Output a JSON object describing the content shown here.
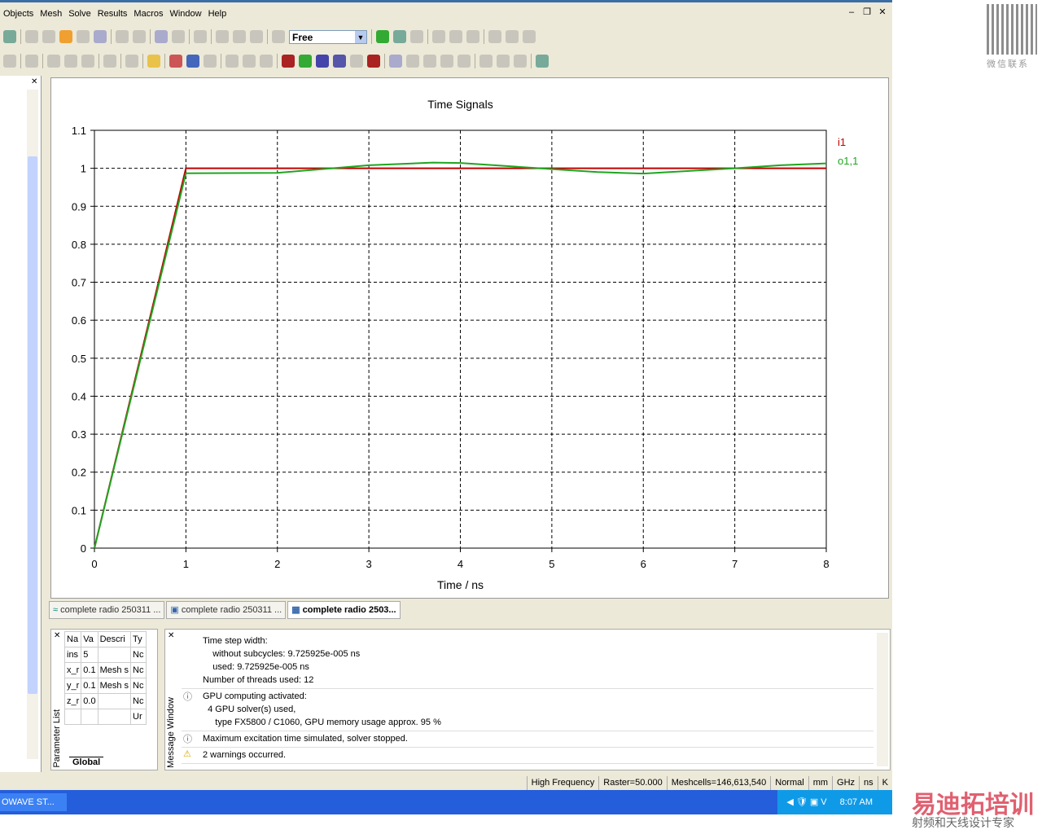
{
  "menu": [
    "Objects",
    "Mesh",
    "Solve",
    "Results",
    "Macros",
    "Window",
    "Help"
  ],
  "toolbar": {
    "view_mode": "Free"
  },
  "chart_tabs": [
    {
      "label": "complete radio 250311 ..."
    },
    {
      "label": "complete radio 250311 ..."
    },
    {
      "label": "complete radio 2503...",
      "active": true
    }
  ],
  "parameter_list": {
    "title": "Parameter List",
    "columns": [
      "Na",
      "Va",
      "Descri",
      "Ty"
    ],
    "rows": [
      [
        "ins",
        "5",
        "",
        "Nc"
      ],
      [
        "x_r",
        "0.1",
        "Mesh s",
        "Nc"
      ],
      [
        "y_r",
        "0.1",
        "Mesh s",
        "Nc"
      ],
      [
        "z_r",
        "0.0",
        "",
        "Nc"
      ],
      [
        "",
        "",
        "",
        "Ur"
      ]
    ],
    "tab": "Global"
  },
  "message_window": {
    "title": "Message Window",
    "messages": [
      {
        "icon": "none",
        "lines": [
          "Time step width:",
          "    without subcycles: 9.725925e-005 ns",
          "    used: 9.725925e-005 ns",
          "Number of threads used: 12"
        ]
      },
      {
        "icon": "info",
        "lines": [
          "GPU computing activated:",
          "  4 GPU solver(s) used,",
          "     type FX5800 / C1060, GPU memory usage approx. 95 %"
        ]
      },
      {
        "icon": "info",
        "lines": [
          "Maximum excitation time simulated, solver stopped."
        ]
      },
      {
        "icon": "warning",
        "lines": [
          "2 warnings occurred."
        ]
      }
    ]
  },
  "status_bar": [
    "High Frequency",
    "Raster=50.000",
    "Meshcells=146,613,540",
    "Normal",
    "mm",
    "GHz",
    "ns",
    "K"
  ],
  "taskbar": {
    "button": "OWAVE ST...",
    "clock": "8:07 AM"
  },
  "watermark": {
    "qr_caption": "微信联系",
    "brand": "易迪拓培训",
    "tagline": "射频和天线设计专家"
  },
  "chart_data": {
    "type": "line",
    "title": "Time Signals",
    "xlabel": "Time / ns",
    "ylabel": "",
    "xlim": [
      0,
      8
    ],
    "ylim": [
      0,
      1.1
    ],
    "grid": true,
    "legend": "right",
    "xticks": [
      "0",
      "1",
      "2",
      "3",
      "4",
      "5",
      "6",
      "7",
      "8"
    ],
    "yticks": [
      "0",
      "0.1",
      "0.2",
      "0.3",
      "0.4",
      "0.5",
      "0.6",
      "0.7",
      "0.8",
      "0.9",
      "1",
      "1.1"
    ],
    "series": [
      {
        "name": "i1",
        "color": "#c00000",
        "x": [
          0,
          1,
          8
        ],
        "y": [
          0,
          1,
          1
        ]
      },
      {
        "name": "o1,1",
        "color": "#1fa51f",
        "x": [
          0,
          1,
          2,
          2.6,
          3,
          3.7,
          4,
          5,
          5.5,
          6,
          6.5,
          7,
          7.5,
          8
        ],
        "y": [
          0,
          0.987,
          0.988,
          1.0,
          1.008,
          1.015,
          1.014,
          0.998,
          0.99,
          0.986,
          0.993,
          1.0,
          1.008,
          1.013
        ]
      }
    ]
  }
}
